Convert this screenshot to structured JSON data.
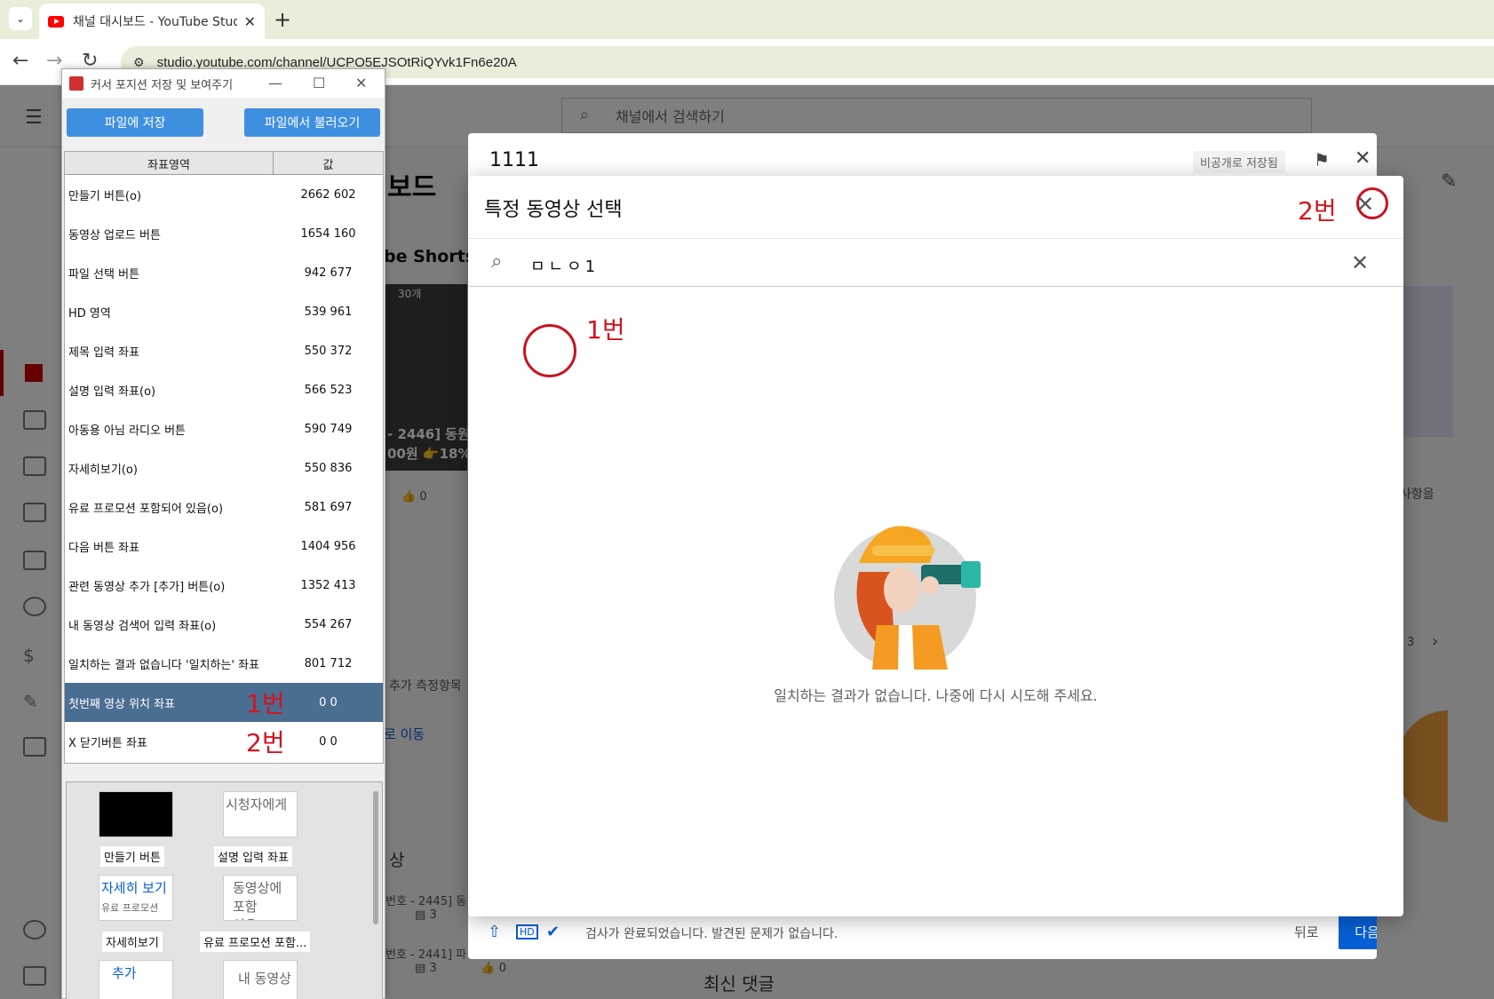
{
  "browser": {
    "tab_title": "채널 대시보드 - YouTube Studio",
    "tab_close": "✕",
    "new_tab": "+",
    "url": "studio.youtube.com/channel/UCPO5EJSOtRiQYvk1Fn6e20A",
    "back": "←",
    "forward": "→",
    "reload": "↻"
  },
  "studio": {
    "search_placeholder": "채널에서 검색하기",
    "page_title": "보드",
    "shorts_label": "be Shorts",
    "thumb_count": "30개",
    "thumb_text": "- 2446] 동원",
    "thumb_text2": "00원 👉18%",
    "like_count": "0",
    "measure_text": "추가 측정항목",
    "goto_text": "로 이동",
    "recent_label": "상",
    "video_num_1": "번호 - 2445] 동",
    "video_num_2": "번호 - 2441] 파",
    "comment_count_1": "3",
    "comment_count_2": "3",
    "like_count_2": "0",
    "comments_title": "최신 댓글",
    "right_text": "사항을",
    "right_num": "3"
  },
  "upload_dialog": {
    "title": "1111",
    "badge": "비공개로 저장됨",
    "status": "검사가 완료되었습니다. 발견된 문제가 없습니다.",
    "back": "뒤로",
    "next": "다음"
  },
  "select_dialog": {
    "title": "특정 동영상 선택",
    "search_value": "ㅁㄴㅇ1",
    "empty_message": "일치하는 결과가 없습니다. 나중에 다시 시도해 주세요."
  },
  "annotations": {
    "label1": "1번",
    "label2": "2번"
  },
  "app": {
    "title": "커서 포지션 저장 및 보여주기",
    "save_button": "파일에 저장",
    "load_button": "파일에서 불러오기",
    "col_area": "좌표영역",
    "col_value": "값",
    "rows": [
      {
        "label": "만들기 버튼(o)",
        "value": "2662 602"
      },
      {
        "label": "동영상 업로드 버튼",
        "value": "1654 160"
      },
      {
        "label": "파일 선택 버튼",
        "value": "942 677"
      },
      {
        "label": "HD 영역",
        "value": "539 961"
      },
      {
        "label": "제목 입력 좌표",
        "value": "550 372"
      },
      {
        "label": "설명 입력 좌표(o)",
        "value": "566 523"
      },
      {
        "label": "아동용 아님 라디오 버튼",
        "value": "590 749"
      },
      {
        "label": "자세히보기(o)",
        "value": "550 836"
      },
      {
        "label": "유료 프로모션 포함되어 있음(o)",
        "value": "581 697"
      },
      {
        "label": "다음 버튼 좌표",
        "value": "1404 956"
      },
      {
        "label": "관련 동영상 추가 [추가] 버튼(o)",
        "value": "1352 413"
      },
      {
        "label": "내 동영상 검색어 입력 좌표(o)",
        "value": "554 267"
      },
      {
        "label": "일치하는 결과 없습니다 '일치하는' 좌표",
        "value": "801 712"
      },
      {
        "label": "첫번째 영상 위치 좌표",
        "value": "0 0"
      },
      {
        "label": "X 닫기버튼 좌표",
        "value": "0 0"
      }
    ],
    "preview": {
      "box2_text": "시청자에게",
      "box3_text": "자세히 보기",
      "box3_sub": "유료 프로모션",
      "box4_text": "동영상에 포함",
      "box4_sub": "있음",
      "box5_text": "추가",
      "box6_text": "내 동영상",
      "label1": "만들기 버튼",
      "label2": "설명 입력 좌표",
      "label3": "자세히보기",
      "label4": "유료 프로모션 포함..."
    }
  }
}
